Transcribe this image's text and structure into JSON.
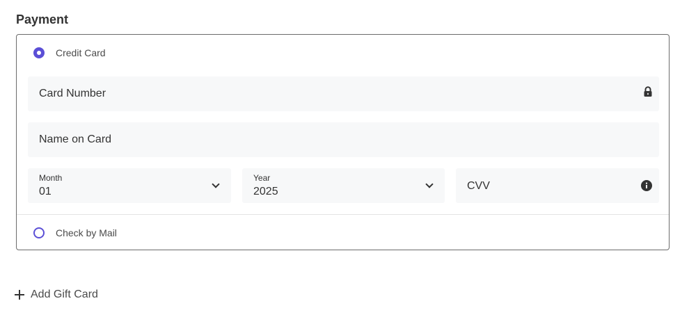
{
  "section": {
    "title": "Payment"
  },
  "payment_methods": [
    {
      "label": "Credit Card",
      "selected": true
    },
    {
      "label": "Check by Mail",
      "selected": false
    }
  ],
  "credit_card": {
    "card_number_placeholder": "Card Number",
    "name_on_card_placeholder": "Name on Card",
    "month": {
      "label": "Month",
      "value": "01"
    },
    "year": {
      "label": "Year",
      "value": "2025"
    },
    "cvv_placeholder": "CVV"
  },
  "gift_card": {
    "label": "Add Gift Card"
  },
  "icons": {
    "card_number": "lock-icon",
    "cvv": "info-icon",
    "month_select": "chevron-down-icon",
    "year_select": "chevron-down-icon",
    "add_gift": "plus-icon"
  },
  "colors": {
    "accent": "#5b4fd6",
    "field_background": "#f7f8f9",
    "border": "#6b6b6b"
  }
}
